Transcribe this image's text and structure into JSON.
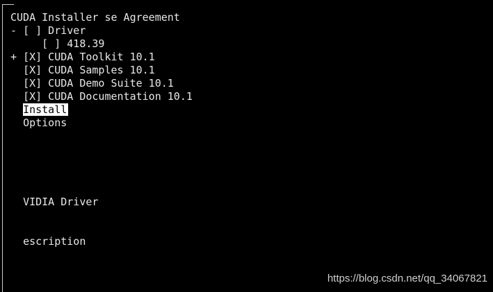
{
  "title": "CUDA Installer se Agreement",
  "menu": {
    "driver": {
      "prefix": "- ",
      "checkbox": "[ ]",
      "label": " Driver"
    },
    "driver_version": {
      "prefix": "     ",
      "checkbox": "[ ]",
      "label": " 418.39"
    },
    "toolkit": {
      "prefix": "+ ",
      "checkbox": "[X]",
      "label": " CUDA Toolkit 10.1"
    },
    "samples": {
      "prefix": "  ",
      "checkbox": "[X]",
      "label": " CUDA Samples 10.1"
    },
    "demo_suite": {
      "prefix": "  ",
      "checkbox": "[X]",
      "label": " CUDA Demo Suite 10.1"
    },
    "documentation": {
      "prefix": "  ",
      "checkbox": "[X]",
      "label": " CUDA Documentation 10.1"
    },
    "install": {
      "prefix": "  ",
      "label": "Install"
    },
    "options": {
      "prefix": "  ",
      "label": "Options"
    }
  },
  "info": {
    "heading": "VIDIA Driver",
    "description": "escription"
  },
  "watermark": "https://blog.csdn.net/qq_34067821",
  "colors": {
    "background": "#000000",
    "text": "#e8e8e8",
    "highlight_bg": "#ffffff",
    "highlight_fg": "#000000"
  }
}
